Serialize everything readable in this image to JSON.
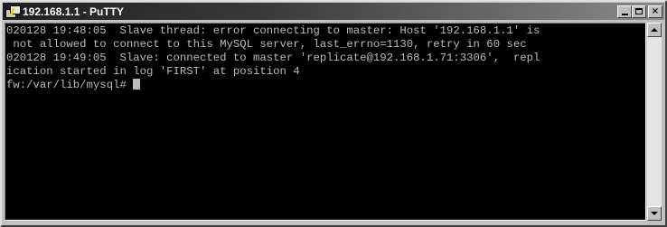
{
  "window": {
    "title": "192.168.1.1 - PuTTY"
  },
  "terminal": {
    "lines": [
      "020128 19:48:05  Slave thread: error connecting to master: Host '192.168.1.1' is",
      " not allowed to connect to this MySQL server, last_errno=1130, retry in 60 sec",
      "020128 19:49:05  Slave: connected to master 'replicate@192.168.1.71:3306',  repl",
      "ication started in log 'FIRST' at position 4",
      "fw:/var/lib/mysql# "
    ]
  },
  "controls": {
    "minimize": "minimize",
    "maximize": "maximize",
    "close": "×"
  },
  "colors": {
    "terminal_bg": "#000000",
    "terminal_fg": "#bbbbbb",
    "title_bar": "#1f1f1f",
    "chrome": "#c0c0c0"
  }
}
